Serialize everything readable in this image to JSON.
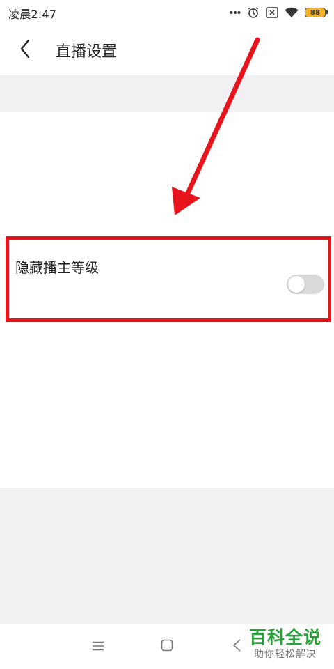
{
  "status_bar": {
    "time": "凌晨2:47",
    "battery_level": "88",
    "icons": [
      "more-dots-icon",
      "alarm-icon",
      "sim-x-icon",
      "wifi-icon",
      "battery-icon"
    ]
  },
  "header": {
    "back_icon": "chevron-left-icon",
    "title": "直播设置"
  },
  "settings": {
    "hide_anchor_level": {
      "label": "隐藏播主等级",
      "enabled": false
    }
  },
  "annotation": {
    "arrow_color": "#e8141b",
    "box_color": "#e8141b"
  },
  "nav_bar": {
    "icons": [
      "menu-icon",
      "home-square-icon",
      "back-triangle-icon"
    ]
  },
  "watermark": {
    "brand": "百科全说",
    "tagline": "助你轻松解决",
    "brand_color": "#2aa13a"
  }
}
